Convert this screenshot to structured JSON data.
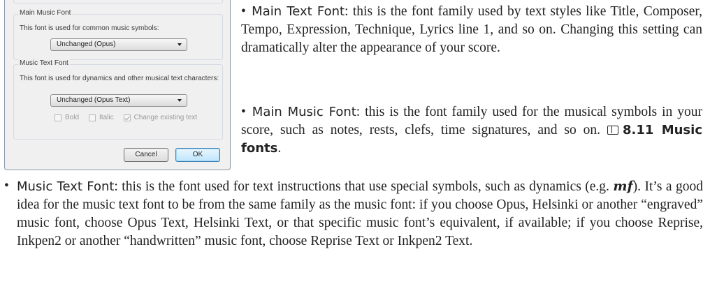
{
  "dialog": {
    "main_music_font": {
      "legend": "Main Music Font",
      "description": "This font is used for common music symbols:",
      "selected": "Unchanged (Opus)"
    },
    "music_text_font": {
      "legend": "Music Text Font",
      "description": "This font is used for dynamics and other musical text characters:",
      "selected": "Unchanged (Opus Text)",
      "bold_label": "Bold",
      "italic_label": "Italic",
      "change_existing_label": "Change existing text"
    },
    "cancel_label": "Cancel",
    "ok_label": "OK"
  },
  "text": {
    "bullet": "•",
    "p1_term": "Main Text Font",
    "p1_body": ": this is the font family used by text styles like Title, Composer, Tempo, Expression, Technique, Lyrics line 1, and so on. Changing this setting can dramatically alter the appearance of your score.",
    "p2_term": "Main Music Font",
    "p2_body": ": this is the font family used for the musical symbols in your score, such as notes, rests, clefs, time signatures, and so on.",
    "p2_ref": "8.11 Music fonts",
    "p2_end": ".",
    "p3_term": "Music Text Font",
    "p3_body_a": ": this is the font used for text instructions that use special symbols, such as dynamics (e.g. ",
    "p3_mf": "mf",
    "p3_body_b": "). It’s a good idea for the music text font to be from the same family as the music font: if you choose Opus, Helsinki or another “engraved” music font, choose Opus Text, Helsinki Text, or that specific music font’s equivalent, if available; if you choose Reprise, Inkpen2 or another “handwritten” music font, choose Reprise Text or Inkpen2 Text."
  }
}
